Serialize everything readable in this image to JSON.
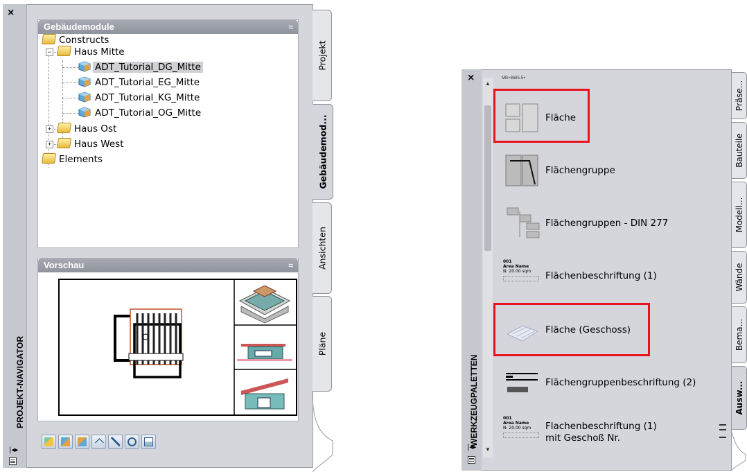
{
  "navigator": {
    "title": "PROJEKT-NAVIGATOR",
    "close_glyph": "×",
    "modules_header": "Gebäudemodule",
    "preview_header": "Vorschau",
    "collapse_glyph": "≈",
    "tree": {
      "constructs": "Constructs",
      "haus_mitte": "Haus Mitte",
      "dg": "ADT_Tutorial_DG_Mitte",
      "eg": "ADT_Tutorial_EG_Mitte",
      "kg": "ADT_Tutorial_KG_Mitte",
      "og": "ADT_Tutorial_OG_Mitte",
      "haus_ost": "Haus Ost",
      "haus_west": "Haus West",
      "elements": "Elements",
      "selected": "ADT_Tutorial_DG_Mitte"
    },
    "tabs": [
      "Projekt",
      "Gebäudemod...",
      "Ansichten",
      "Pläne"
    ],
    "active_tab": "Gebäudemod...",
    "toolbar_icons": [
      "add-module-icon",
      "copy-module-icon",
      "module-properties-icon",
      "link-icon",
      "select-icon",
      "refresh-icon",
      "repath-icon"
    ]
  },
  "palette": {
    "title": "WERKZEUGPALETTEN",
    "close_glyph": "×",
    "top_label": "MB+8685-5+",
    "items": [
      {
        "label": "Fläche",
        "icon": "area-icon",
        "highlighted": true
      },
      {
        "label": "Flächengruppe",
        "icon": "area-group-icon",
        "highlighted": false
      },
      {
        "label": "Flächengruppen - DIN 277",
        "icon": "area-group-tree-icon",
        "highlighted": false
      },
      {
        "label": "Flächenbeschriftung (1)",
        "icon": "area-tag-icon",
        "highlighted": false
      },
      {
        "label": "Fläche (Geschoss)",
        "icon": "floor-area-icon",
        "highlighted": true
      },
      {
        "label": "Flächengruppenbeschriftung (2)",
        "icon": "area-group-tag-icon",
        "highlighted": false
      },
      {
        "label": "Flachenbeschriftung (1)",
        "label2": "mit Geschoß Nr.",
        "icon": "area-tag-floor-icon",
        "highlighted": false
      }
    ],
    "tag_text": {
      "num": "001",
      "name": "Area Name",
      "size": "N: 20.00 sqm"
    },
    "tabs": [
      "Präse...",
      "Bauteile",
      "Modell...",
      "Wände",
      "Bema...",
      "Ausw..."
    ],
    "active_tab": "Ausw..."
  },
  "colors": {
    "highlight": "#e8141d",
    "panel": "#d4d6dc",
    "header": "#9a9da5"
  }
}
